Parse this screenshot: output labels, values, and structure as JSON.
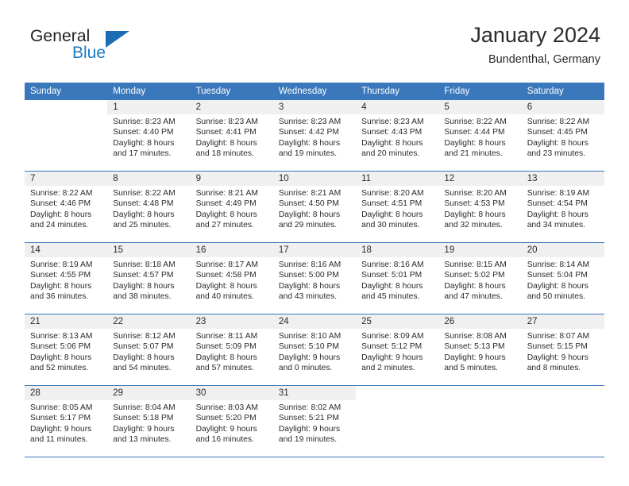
{
  "brand": {
    "name_part1": "General",
    "name_part2": "Blue",
    "mark": "triangle-icon"
  },
  "header": {
    "title": "January 2024",
    "subtitle": "Bundenthal, Germany"
  },
  "colors": {
    "header_blue": "#3a77bb",
    "brand_blue": "#1b7bc4",
    "mark_blue": "#1b6cb3",
    "daynum_bg": "#f0f0f0",
    "text": "#2b2b2b"
  },
  "weekday_headers": [
    "Sunday",
    "Monday",
    "Tuesday",
    "Wednesday",
    "Thursday",
    "Friday",
    "Saturday"
  ],
  "labels": {
    "sunrise_prefix": "Sunrise: ",
    "sunset_prefix": "Sunset: ",
    "daylight_prefix": "Daylight: "
  },
  "weeks": [
    [
      {
        "day": "",
        "line1": "",
        "line2": "",
        "line3": "",
        "line4": ""
      },
      {
        "day": "1",
        "line1": "Sunrise: 8:23 AM",
        "line2": "Sunset: 4:40 PM",
        "line3": "Daylight: 8 hours",
        "line4": "and 17 minutes."
      },
      {
        "day": "2",
        "line1": "Sunrise: 8:23 AM",
        "line2": "Sunset: 4:41 PM",
        "line3": "Daylight: 8 hours",
        "line4": "and 18 minutes."
      },
      {
        "day": "3",
        "line1": "Sunrise: 8:23 AM",
        "line2": "Sunset: 4:42 PM",
        "line3": "Daylight: 8 hours",
        "line4": "and 19 minutes."
      },
      {
        "day": "4",
        "line1": "Sunrise: 8:23 AM",
        "line2": "Sunset: 4:43 PM",
        "line3": "Daylight: 8 hours",
        "line4": "and 20 minutes."
      },
      {
        "day": "5",
        "line1": "Sunrise: 8:22 AM",
        "line2": "Sunset: 4:44 PM",
        "line3": "Daylight: 8 hours",
        "line4": "and 21 minutes."
      },
      {
        "day": "6",
        "line1": "Sunrise: 8:22 AM",
        "line2": "Sunset: 4:45 PM",
        "line3": "Daylight: 8 hours",
        "line4": "and 23 minutes."
      }
    ],
    [
      {
        "day": "7",
        "line1": "Sunrise: 8:22 AM",
        "line2": "Sunset: 4:46 PM",
        "line3": "Daylight: 8 hours",
        "line4": "and 24 minutes."
      },
      {
        "day": "8",
        "line1": "Sunrise: 8:22 AM",
        "line2": "Sunset: 4:48 PM",
        "line3": "Daylight: 8 hours",
        "line4": "and 25 minutes."
      },
      {
        "day": "9",
        "line1": "Sunrise: 8:21 AM",
        "line2": "Sunset: 4:49 PM",
        "line3": "Daylight: 8 hours",
        "line4": "and 27 minutes."
      },
      {
        "day": "10",
        "line1": "Sunrise: 8:21 AM",
        "line2": "Sunset: 4:50 PM",
        "line3": "Daylight: 8 hours",
        "line4": "and 29 minutes."
      },
      {
        "day": "11",
        "line1": "Sunrise: 8:20 AM",
        "line2": "Sunset: 4:51 PM",
        "line3": "Daylight: 8 hours",
        "line4": "and 30 minutes."
      },
      {
        "day": "12",
        "line1": "Sunrise: 8:20 AM",
        "line2": "Sunset: 4:53 PM",
        "line3": "Daylight: 8 hours",
        "line4": "and 32 minutes."
      },
      {
        "day": "13",
        "line1": "Sunrise: 8:19 AM",
        "line2": "Sunset: 4:54 PM",
        "line3": "Daylight: 8 hours",
        "line4": "and 34 minutes."
      }
    ],
    [
      {
        "day": "14",
        "line1": "Sunrise: 8:19 AM",
        "line2": "Sunset: 4:55 PM",
        "line3": "Daylight: 8 hours",
        "line4": "and 36 minutes."
      },
      {
        "day": "15",
        "line1": "Sunrise: 8:18 AM",
        "line2": "Sunset: 4:57 PM",
        "line3": "Daylight: 8 hours",
        "line4": "and 38 minutes."
      },
      {
        "day": "16",
        "line1": "Sunrise: 8:17 AM",
        "line2": "Sunset: 4:58 PM",
        "line3": "Daylight: 8 hours",
        "line4": "and 40 minutes."
      },
      {
        "day": "17",
        "line1": "Sunrise: 8:16 AM",
        "line2": "Sunset: 5:00 PM",
        "line3": "Daylight: 8 hours",
        "line4": "and 43 minutes."
      },
      {
        "day": "18",
        "line1": "Sunrise: 8:16 AM",
        "line2": "Sunset: 5:01 PM",
        "line3": "Daylight: 8 hours",
        "line4": "and 45 minutes."
      },
      {
        "day": "19",
        "line1": "Sunrise: 8:15 AM",
        "line2": "Sunset: 5:02 PM",
        "line3": "Daylight: 8 hours",
        "line4": "and 47 minutes."
      },
      {
        "day": "20",
        "line1": "Sunrise: 8:14 AM",
        "line2": "Sunset: 5:04 PM",
        "line3": "Daylight: 8 hours",
        "line4": "and 50 minutes."
      }
    ],
    [
      {
        "day": "21",
        "line1": "Sunrise: 8:13 AM",
        "line2": "Sunset: 5:06 PM",
        "line3": "Daylight: 8 hours",
        "line4": "and 52 minutes."
      },
      {
        "day": "22",
        "line1": "Sunrise: 8:12 AM",
        "line2": "Sunset: 5:07 PM",
        "line3": "Daylight: 8 hours",
        "line4": "and 54 minutes."
      },
      {
        "day": "23",
        "line1": "Sunrise: 8:11 AM",
        "line2": "Sunset: 5:09 PM",
        "line3": "Daylight: 8 hours",
        "line4": "and 57 minutes."
      },
      {
        "day": "24",
        "line1": "Sunrise: 8:10 AM",
        "line2": "Sunset: 5:10 PM",
        "line3": "Daylight: 9 hours",
        "line4": "and 0 minutes."
      },
      {
        "day": "25",
        "line1": "Sunrise: 8:09 AM",
        "line2": "Sunset: 5:12 PM",
        "line3": "Daylight: 9 hours",
        "line4": "and 2 minutes."
      },
      {
        "day": "26",
        "line1": "Sunrise: 8:08 AM",
        "line2": "Sunset: 5:13 PM",
        "line3": "Daylight: 9 hours",
        "line4": "and 5 minutes."
      },
      {
        "day": "27",
        "line1": "Sunrise: 8:07 AM",
        "line2": "Sunset: 5:15 PM",
        "line3": "Daylight: 9 hours",
        "line4": "and 8 minutes."
      }
    ],
    [
      {
        "day": "28",
        "line1": "Sunrise: 8:05 AM",
        "line2": "Sunset: 5:17 PM",
        "line3": "Daylight: 9 hours",
        "line4": "and 11 minutes."
      },
      {
        "day": "29",
        "line1": "Sunrise: 8:04 AM",
        "line2": "Sunset: 5:18 PM",
        "line3": "Daylight: 9 hours",
        "line4": "and 13 minutes."
      },
      {
        "day": "30",
        "line1": "Sunrise: 8:03 AM",
        "line2": "Sunset: 5:20 PM",
        "line3": "Daylight: 9 hours",
        "line4": "and 16 minutes."
      },
      {
        "day": "31",
        "line1": "Sunrise: 8:02 AM",
        "line2": "Sunset: 5:21 PM",
        "line3": "Daylight: 9 hours",
        "line4": "and 19 minutes."
      },
      {
        "day": "",
        "line1": "",
        "line2": "",
        "line3": "",
        "line4": ""
      },
      {
        "day": "",
        "line1": "",
        "line2": "",
        "line3": "",
        "line4": ""
      },
      {
        "day": "",
        "line1": "",
        "line2": "",
        "line3": "",
        "line4": ""
      }
    ]
  ]
}
